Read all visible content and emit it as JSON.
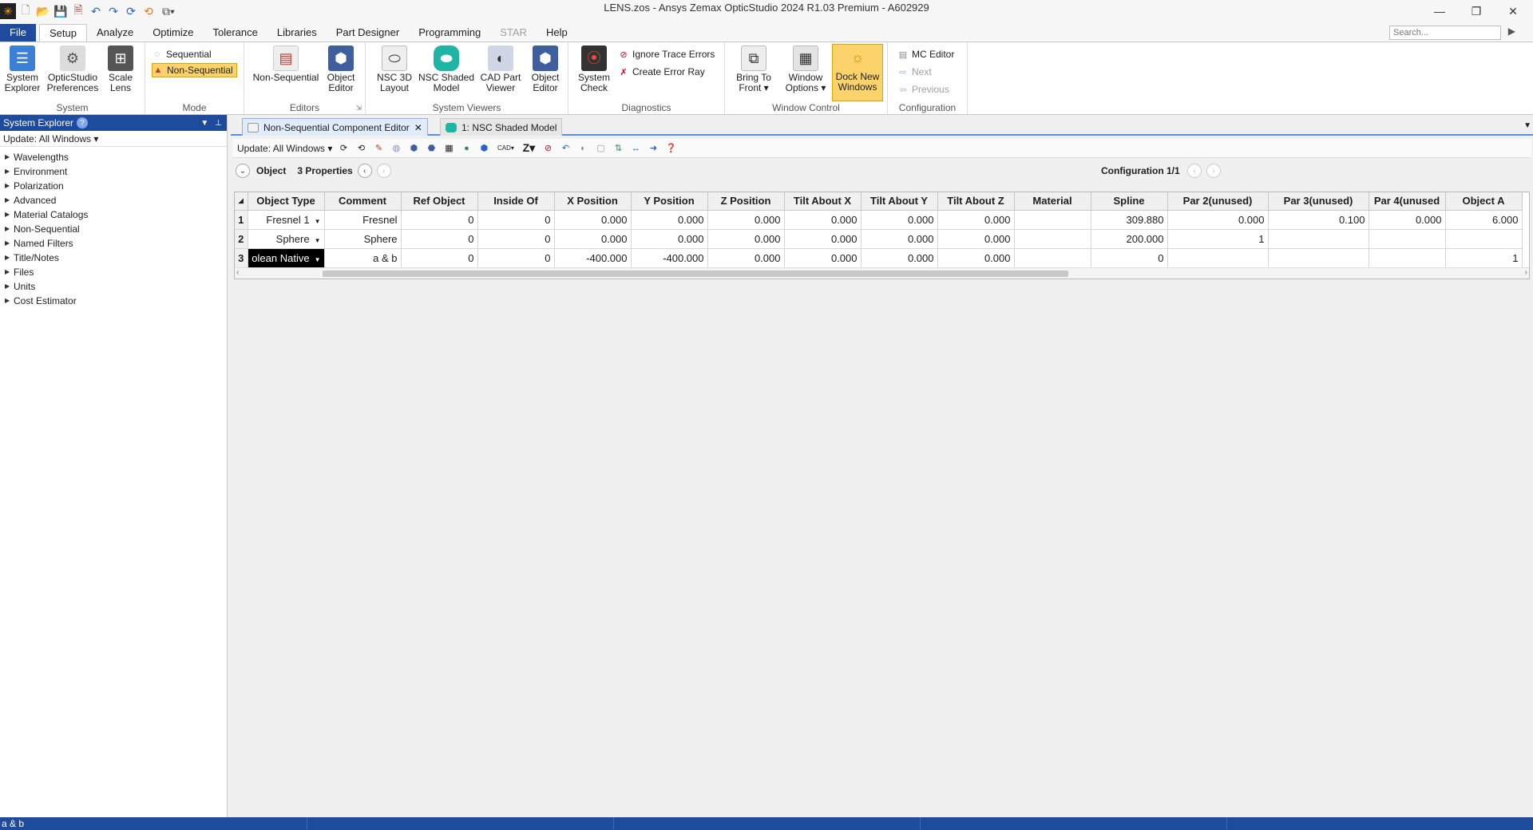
{
  "window": {
    "title": "LENS.zos - Ansys Zemax OpticStudio 2024 R1.03   Premium - A602929",
    "minimize": "—",
    "restore": "❐",
    "close": "✕"
  },
  "ribbon_tabs": [
    "File",
    "Setup",
    "Analyze",
    "Optimize",
    "Tolerance",
    "Libraries",
    "Part Designer",
    "Programming",
    "STAR",
    "Help"
  ],
  "search": {
    "placeholder": "Search..."
  },
  "ribbon": {
    "system": {
      "label": "System",
      "explorer": [
        "System",
        "Explorer"
      ],
      "preferences": [
        "OpticStudio",
        "Preferences"
      ],
      "scale": [
        "Scale",
        "Lens"
      ]
    },
    "mode": {
      "label": "Mode",
      "sequential": "Sequential",
      "non_sequential": "Non-Sequential"
    },
    "editors": {
      "label": "Editors",
      "non_sequential": "Non-Sequential",
      "object_editor": [
        "Object",
        "Editor"
      ]
    },
    "system_viewers": {
      "label": "System Viewers",
      "nsc_3d_layout": [
        "NSC 3D",
        "Layout"
      ],
      "nsc_shaded_model": [
        "NSC Shaded",
        "Model"
      ],
      "cad_part_viewer": [
        "CAD Part",
        "Viewer"
      ],
      "object_editor": [
        "Object",
        "Editor"
      ]
    },
    "diagnostics": {
      "label": "Diagnostics",
      "system_check": [
        "System",
        "Check"
      ],
      "ignore_trace_errors": "Ignore Trace Errors",
      "create_error_ray": "Create Error Ray"
    },
    "window_control": {
      "label": "Window Control",
      "bring_to_front": [
        "Bring To",
        "Front ▾"
      ],
      "window_options": [
        "Window",
        "Options ▾"
      ],
      "dock_new_windows": [
        "Dock New",
        "Windows"
      ]
    },
    "configuration": {
      "label": "Configuration",
      "mc_editor": "MC Editor",
      "next": "Next",
      "previous": "Previous"
    }
  },
  "system_explorer": {
    "title": "System Explorer",
    "update": "Update: All Windows ▾",
    "items": [
      "Wavelengths",
      "Environment",
      "Polarization",
      "Advanced",
      "Material Catalogs",
      "Non-Sequential",
      "Named Filters",
      "Title/Notes",
      "Files",
      "Units",
      "Cost Estimator"
    ]
  },
  "doc_tabs": [
    {
      "label": "Non-Sequential Component Editor",
      "close": "✕"
    },
    {
      "label": "1: NSC Shaded Model"
    }
  ],
  "editor": {
    "update": "Update: All Windows ▾",
    "object_label": "Object",
    "properties_label": "3 Properties",
    "configuration": "Configuration 1/1",
    "columns": [
      "Object Type",
      "Comment",
      "Ref Object",
      "Inside Of",
      "X Position",
      "Y Position",
      "Z Position",
      "Tilt About X",
      "Tilt About Y",
      "Tilt About Z",
      "Material",
      "Spline",
      "Par 2(unused)",
      "Par 3(unused)",
      "Par 4(unused",
      "Object A"
    ],
    "rows": [
      {
        "num": "1",
        "type": "Fresnel 1",
        "comment": "Fresnel",
        "ref": "0",
        "inside": "0",
        "x": "0.000",
        "y": "0.000",
        "z": "0.000",
        "tx": "0.000",
        "ty": "0.000",
        "tz": "0.000",
        "material": "",
        "spline": "309.880",
        "par2": "0.000",
        "par3": "0.100",
        "par4": "0.000",
        "objA": "6.000"
      },
      {
        "num": "2",
        "type": "Sphere",
        "comment": "Sphere",
        "ref": "0",
        "inside": "0",
        "x": "0.000",
        "y": "0.000",
        "z": "0.000",
        "tx": "0.000",
        "ty": "0.000",
        "tz": "0.000",
        "material": "",
        "spline": "200.000",
        "par2": "1",
        "par3": "",
        "par4": "",
        "objA": ""
      },
      {
        "num": "3",
        "type": "olean Native",
        "comment": "a & b",
        "ref": "0",
        "inside": "0",
        "x": "-400.000",
        "y": "-400.000",
        "z": "0.000",
        "tx": "0.000",
        "ty": "0.000",
        "tz": "0.000",
        "material": "",
        "spline": "0",
        "par2": "",
        "par3": "",
        "par4": "",
        "objA": "1"
      }
    ]
  },
  "status": {
    "text": "a & b"
  },
  "colors": {
    "brand_blue": "#1e4b9c",
    "highlight": "#fbd36a",
    "selected_cell": "#000000"
  }
}
